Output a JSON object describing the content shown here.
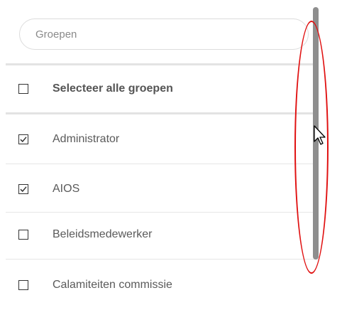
{
  "search": {
    "placeholder": "Groepen",
    "value": ""
  },
  "select_all": {
    "label": "Selecteer alle groepen",
    "checked": false
  },
  "groups": [
    {
      "label": "Administrator",
      "checked": true
    },
    {
      "label": "AIOS",
      "checked": true
    },
    {
      "label": "Beleidsmedewerker",
      "checked": false
    },
    {
      "label": "Calamiteiten commissie",
      "checked": false
    }
  ],
  "colors": {
    "highlight": "#e01010",
    "scrollbar": "#8e8e8e"
  },
  "icons": {
    "checkbox_checked": "checkmark-icon",
    "cursor": "mouse-pointer-icon"
  }
}
